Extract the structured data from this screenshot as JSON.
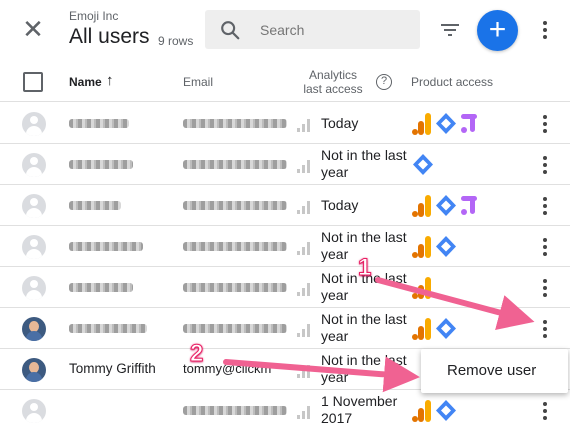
{
  "header": {
    "org_name": "Emoji Inc",
    "title": "All users",
    "row_count": "9 rows",
    "search_placeholder": "Search"
  },
  "columns": {
    "name": "Name",
    "email": "Email",
    "analytics_line1": "Analytics",
    "analytics_line2": "last access",
    "help": "?",
    "product_access": "Product access"
  },
  "rows": [
    {
      "name": "",
      "email": "",
      "access_line1": "Today",
      "access_line2": "",
      "products": [
        "analytics",
        "tagmanager",
        "optimize"
      ],
      "avatar": "placeholder"
    },
    {
      "name": "",
      "email": "",
      "access_line1": "Not in the last",
      "access_line2": "year",
      "products": [
        "tagmanager"
      ],
      "avatar": "placeholder"
    },
    {
      "name": "",
      "email": "",
      "access_line1": "Today",
      "access_line2": "",
      "products": [
        "analytics",
        "tagmanager",
        "optimize"
      ],
      "avatar": "placeholder"
    },
    {
      "name": "",
      "email": "",
      "access_line1": "Not in the last",
      "access_line2": "year",
      "products": [
        "analytics",
        "tagmanager"
      ],
      "avatar": "placeholder"
    },
    {
      "name": "",
      "email": "",
      "access_line1": "Not in the last",
      "access_line2": "year",
      "products": [
        "analytics"
      ],
      "avatar": "placeholder"
    },
    {
      "name": "",
      "email": "",
      "access_line1": "Not in the last",
      "access_line2": "year",
      "products": [
        "analytics",
        "tagmanager"
      ],
      "avatar": "photo"
    },
    {
      "name": "Tommy Griffith",
      "email": "tommy@clickm",
      "access_line1": "Not in the last",
      "access_line2": "year",
      "products": [],
      "avatar": "photo"
    },
    {
      "name": "",
      "email": "",
      "access_line1": "1 November",
      "access_line2": "2017",
      "products": [
        "analytics",
        "tagmanager"
      ],
      "avatar": "placeholder"
    }
  ],
  "context_menu": {
    "remove_user": "Remove user"
  },
  "annotations": {
    "step1": "1",
    "step2": "2"
  },
  "colors": {
    "accent": "#1a73e8",
    "annotation": "#f06292",
    "analytics_orange": "#f9ab00",
    "analytics_dark": "#e37400",
    "tagmanager_blue": "#4285f4",
    "optimize_purple": "#b366f6"
  }
}
